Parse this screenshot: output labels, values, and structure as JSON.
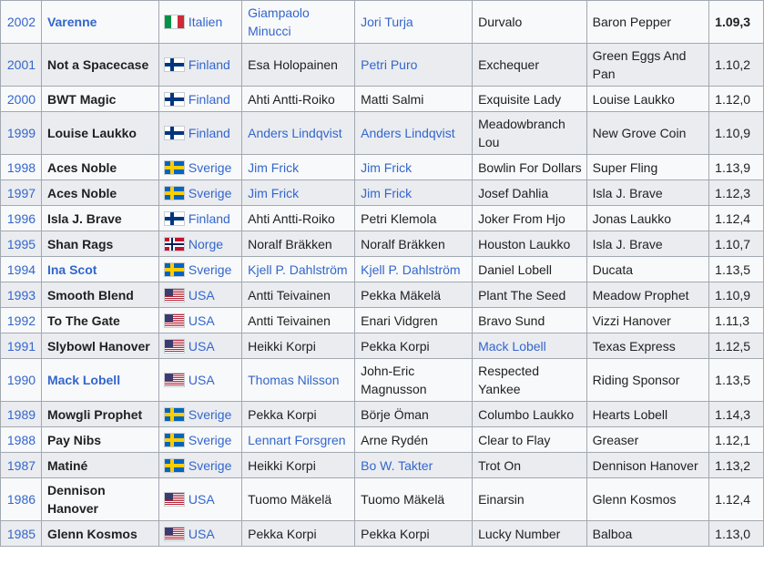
{
  "colors": {
    "link": "#3366cc",
    "text": "#202122",
    "border": "#a2a9b1",
    "row_light": "#f8f9fa",
    "row_striped": "#eaecf0"
  },
  "table": {
    "rows": [
      {
        "year": "2002",
        "horse": "Varenne",
        "horse_link": true,
        "flag": "italy",
        "country": "Italien",
        "trainer": "Giampaolo Minucci",
        "trainer_link": true,
        "driver": "Jori Turja",
        "driver_link": true,
        "second": "Durvalo",
        "second_link": false,
        "third": "Baron Pepper",
        "time": "1.09,3",
        "time_bold": true
      },
      {
        "year": "2001",
        "horse": "Not a Spacecase",
        "horse_link": false,
        "flag": "finland",
        "country": "Finland",
        "trainer": "Esa Holopainen",
        "trainer_link": false,
        "driver": "Petri Puro",
        "driver_link": true,
        "second": "Exchequer",
        "second_link": false,
        "third": "Green Eggs And Pan",
        "time": "1.10,2",
        "time_bold": false
      },
      {
        "year": "2000",
        "horse": "BWT Magic",
        "horse_link": false,
        "flag": "finland",
        "country": "Finland",
        "trainer": "Ahti Antti-Roiko",
        "trainer_link": false,
        "driver": "Matti Salmi",
        "driver_link": false,
        "second": "Exquisite Lady",
        "second_link": false,
        "third": "Louise Laukko",
        "time": "1.12,0",
        "time_bold": false
      },
      {
        "year": "1999",
        "horse": "Louise Laukko",
        "horse_link": false,
        "flag": "finland",
        "country": "Finland",
        "trainer": "Anders Lindqvist",
        "trainer_link": true,
        "driver": "Anders Lindqvist",
        "driver_link": true,
        "second": "Meadowbranch Lou",
        "second_link": false,
        "third": "New Grove Coin",
        "time": "1.10,9",
        "time_bold": false
      },
      {
        "year": "1998",
        "horse": "Aces Noble",
        "horse_link": false,
        "flag": "sweden",
        "country": "Sverige",
        "trainer": "Jim Frick",
        "trainer_link": true,
        "driver": "Jim Frick",
        "driver_link": true,
        "second": "Bowlin For Dollars",
        "second_link": false,
        "third": "Super Fling",
        "time": "1.13,9",
        "time_bold": false
      },
      {
        "year": "1997",
        "horse": "Aces Noble",
        "horse_link": false,
        "flag": "sweden",
        "country": "Sverige",
        "trainer": "Jim Frick",
        "trainer_link": true,
        "driver": "Jim Frick",
        "driver_link": true,
        "second": "Josef Dahlia",
        "second_link": false,
        "third": "Isla J. Brave",
        "time": "1.12,3",
        "time_bold": false
      },
      {
        "year": "1996",
        "horse": "Isla J. Brave",
        "horse_link": false,
        "flag": "finland",
        "country": "Finland",
        "trainer": "Ahti Antti-Roiko",
        "trainer_link": false,
        "driver": "Petri Klemola",
        "driver_link": false,
        "second": "Joker From Hjo",
        "second_link": false,
        "third": "Jonas Laukko",
        "time": "1.12,4",
        "time_bold": false
      },
      {
        "year": "1995",
        "horse": "Shan Rags",
        "horse_link": false,
        "flag": "norway",
        "country": "Norge",
        "trainer": "Noralf Bräkken",
        "trainer_link": false,
        "driver": "Noralf Bräkken",
        "driver_link": false,
        "second": "Houston Laukko",
        "second_link": false,
        "third": "Isla J. Brave",
        "time": "1.10,7",
        "time_bold": false
      },
      {
        "year": "1994",
        "horse": "Ina Scot",
        "horse_link": true,
        "flag": "sweden",
        "country": "Sverige",
        "trainer": "Kjell P. Dahlström",
        "trainer_link": true,
        "driver": "Kjell P. Dahlström",
        "driver_link": true,
        "second": "Daniel Lobell",
        "second_link": false,
        "third": "Ducata",
        "time": "1.13,5",
        "time_bold": false
      },
      {
        "year": "1993",
        "horse": "Smooth Blend",
        "horse_link": false,
        "flag": "usa",
        "country": "USA",
        "trainer": "Antti Teivainen",
        "trainer_link": false,
        "driver": "Pekka Mäkelä",
        "driver_link": false,
        "second": "Plant The Seed",
        "second_link": false,
        "third": "Meadow Prophet",
        "time": "1.10,9",
        "time_bold": false
      },
      {
        "year": "1992",
        "horse": "To The Gate",
        "horse_link": false,
        "flag": "usa",
        "country": "USA",
        "trainer": "Antti Teivainen",
        "trainer_link": false,
        "driver": "Enari Vidgren",
        "driver_link": false,
        "second": "Bravo Sund",
        "second_link": false,
        "third": "Vizzi Hanover",
        "time": "1.11,3",
        "time_bold": false
      },
      {
        "year": "1991",
        "horse": "Slybowl Hanover",
        "horse_link": false,
        "flag": "usa",
        "country": "USA",
        "trainer": "Heikki Korpi",
        "trainer_link": false,
        "driver": "Pekka Korpi",
        "driver_link": false,
        "second": "Mack Lobell",
        "second_link": true,
        "third": "Texas Express",
        "time": "1.12,5",
        "time_bold": false
      },
      {
        "year": "1990",
        "horse": "Mack Lobell",
        "horse_link": true,
        "flag": "usa",
        "country": "USA",
        "trainer": "Thomas Nilsson",
        "trainer_link": true,
        "driver": "John-Eric Magnusson",
        "driver_link": false,
        "second": "Respected Yankee",
        "second_link": false,
        "third": "Riding Sponsor",
        "time": "1.13,5",
        "time_bold": false
      },
      {
        "year": "1989",
        "horse": "Mowgli Prophet",
        "horse_link": false,
        "flag": "sweden",
        "country": "Sverige",
        "trainer": "Pekka Korpi",
        "trainer_link": false,
        "driver": "Börje Öman",
        "driver_link": false,
        "second": "Columbo Laukko",
        "second_link": false,
        "third": "Hearts Lobell",
        "time": "1.14,3",
        "time_bold": false
      },
      {
        "year": "1988",
        "horse": "Pay Nibs",
        "horse_link": false,
        "flag": "sweden",
        "country": "Sverige",
        "trainer": "Lennart Forsgren",
        "trainer_link": true,
        "driver": "Arne Rydén",
        "driver_link": false,
        "second": "Clear to Flay",
        "second_link": false,
        "third": "Greaser",
        "time": "1.12,1",
        "time_bold": false
      },
      {
        "year": "1987",
        "horse": "Matiné",
        "horse_link": false,
        "flag": "sweden",
        "country": "Sverige",
        "trainer": "Heikki Korpi",
        "trainer_link": false,
        "driver": "Bo W. Takter",
        "driver_link": true,
        "second": "Trot On",
        "second_link": false,
        "third": "Dennison Hanover",
        "time": "1.13,2",
        "time_bold": false
      },
      {
        "year": "1986",
        "horse": "Dennison Hanover",
        "horse_link": false,
        "flag": "usa",
        "country": "USA",
        "trainer": "Tuomo Mäkelä",
        "trainer_link": false,
        "driver": "Tuomo Mäkelä",
        "driver_link": false,
        "second": "Einarsin",
        "second_link": false,
        "third": "Glenn Kosmos",
        "time": "1.12,4",
        "time_bold": false
      },
      {
        "year": "1985",
        "horse": "Glenn Kosmos",
        "horse_link": false,
        "flag": "usa",
        "country": "USA",
        "trainer": "Pekka Korpi",
        "trainer_link": false,
        "driver": "Pekka Korpi",
        "driver_link": false,
        "second": "Lucky Number",
        "second_link": false,
        "third": "Balboa",
        "time": "1.13,0",
        "time_bold": false
      }
    ]
  }
}
